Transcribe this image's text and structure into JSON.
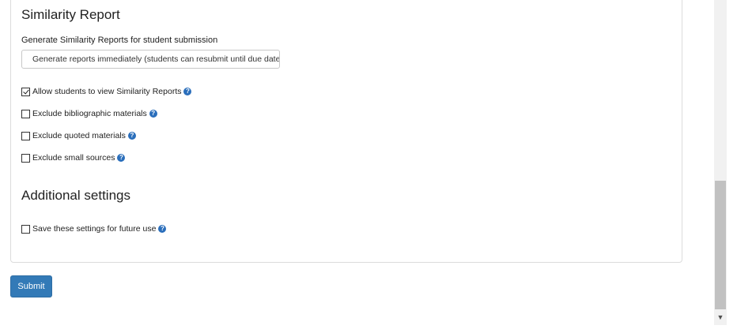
{
  "similarity_report": {
    "title": "Similarity Report",
    "generate_label": "Generate Similarity Reports for student submission",
    "generate_select_value": "Generate reports immediately (students can resubmit until due date)",
    "options": [
      {
        "label": "Allow students to view Similarity Reports",
        "checked": true,
        "help_icon": "question-circle-icon"
      },
      {
        "label": "Exclude bibliographic materials",
        "checked": false,
        "help_icon": "question-circle-icon"
      },
      {
        "label": "Exclude quoted materials",
        "checked": false,
        "help_icon": "question-circle-icon"
      },
      {
        "label": "Exclude small sources",
        "checked": false,
        "help_icon": "question-circle-icon"
      }
    ]
  },
  "additional_settings": {
    "title": "Additional settings",
    "save_label": "Save these settings for future use",
    "save_checked": false
  },
  "form": {
    "submit_label": "Submit"
  },
  "colors": {
    "accent": "#337ab7",
    "help_icon": "#2a6ebb",
    "panel_border": "#dcdcdc"
  }
}
